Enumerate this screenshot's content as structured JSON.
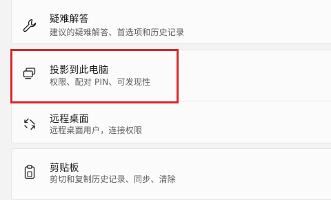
{
  "settings": {
    "items": [
      {
        "title": "疑难解答",
        "description": "建议的疑难解答、首选项和历史记录",
        "icon": "wrench-icon"
      },
      {
        "title": "投影到此电脑",
        "description": "权限、配对 PIN、可发现性",
        "icon": "project-to-pc-icon"
      },
      {
        "title": "远程桌面",
        "description": "远程桌面用户，连接权限",
        "icon": "remote-desktop-icon"
      },
      {
        "title": "剪贴板",
        "description": "剪切和复制历史记录、同步、清除",
        "icon": "clipboard-icon"
      }
    ]
  },
  "colors": {
    "background": "#f3f3f3",
    "card": "#fbfbfb",
    "highlight": "#d9252a"
  }
}
